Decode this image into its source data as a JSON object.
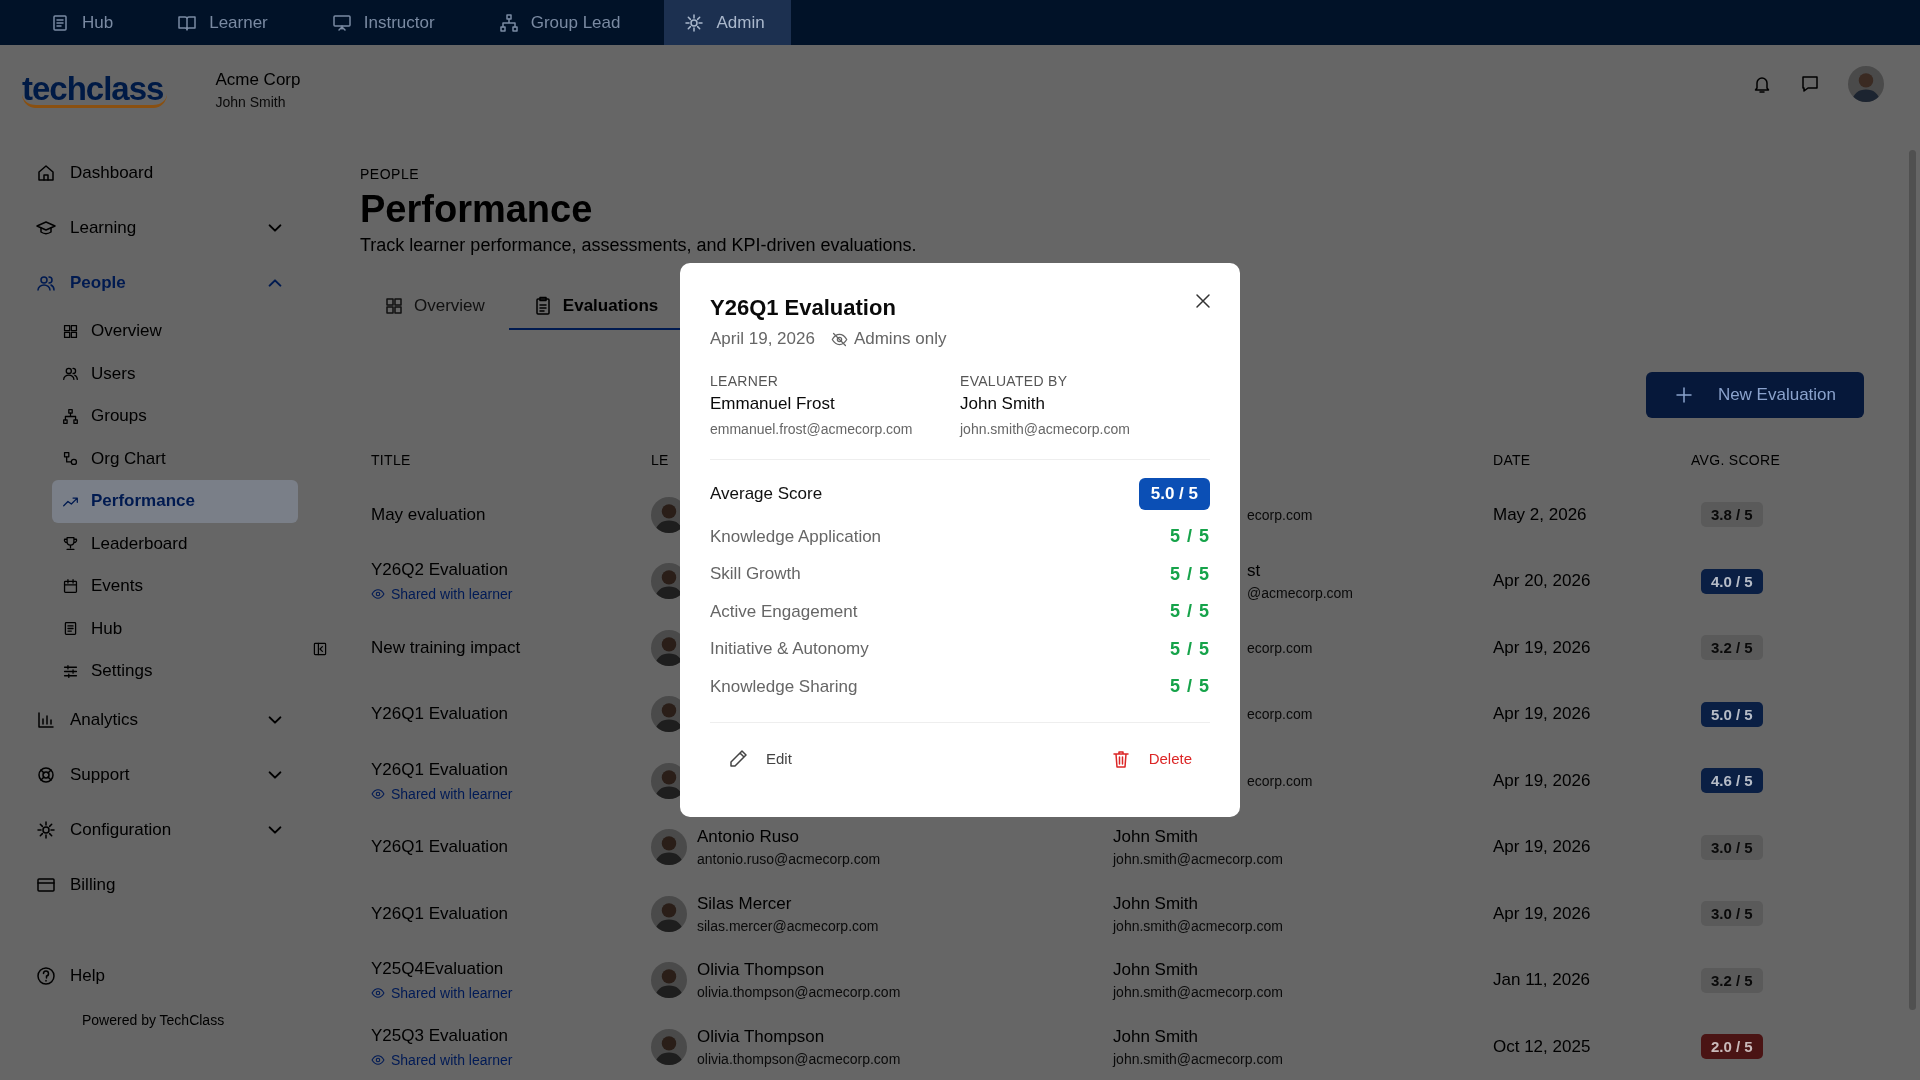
{
  "top_nav": [
    {
      "label": "Hub",
      "selected": false
    },
    {
      "label": "Learner",
      "selected": false
    },
    {
      "label": "Instructor",
      "selected": false
    },
    {
      "label": "Group Lead",
      "selected": false
    },
    {
      "label": "Admin",
      "selected": true
    }
  ],
  "header": {
    "logo": "techclass",
    "org": "Acme Corp",
    "user": "John Smith"
  },
  "sidebar": {
    "items": [
      {
        "label": "Dashboard",
        "selected": false
      },
      {
        "label": "Learning",
        "selected": false,
        "expanded": false
      },
      {
        "label": "People",
        "selected": false,
        "expanded": true,
        "children": [
          {
            "label": "Overview",
            "selected": false
          },
          {
            "label": "Users",
            "selected": false
          },
          {
            "label": "Groups",
            "selected": false
          },
          {
            "label": "Org Chart",
            "selected": false
          },
          {
            "label": "Performance",
            "selected": true
          },
          {
            "label": "Leaderboard",
            "selected": false
          },
          {
            "label": "Events",
            "selected": false
          },
          {
            "label": "Hub",
            "selected": false
          },
          {
            "label": "Settings",
            "selected": false
          }
        ]
      },
      {
        "label": "Analytics",
        "selected": false,
        "expanded": false
      },
      {
        "label": "Support",
        "selected": false,
        "expanded": false
      },
      {
        "label": "Configuration",
        "selected": false,
        "expanded": false
      },
      {
        "label": "Billing",
        "selected": false
      }
    ],
    "help": "Help",
    "footer": "Powered by TechClass"
  },
  "page": {
    "eyebrow": "PEOPLE",
    "title": "Performance",
    "subtitle": "Track learner performance, assessments, and KPI-driven evaluations."
  },
  "tabs": [
    {
      "label": "Overview",
      "selected": false
    },
    {
      "label": "Evaluations",
      "selected": true
    }
  ],
  "new_button": "New Evaluation",
  "table": {
    "columns": [
      "TITLE",
      "LE",
      "DATE",
      "AVG. SCORE"
    ],
    "rows": [
      {
        "title": "May evaluation",
        "evaluator": {
          "email": "ecorp.com"
        },
        "date": "May 2, 2026",
        "score": "3.8 / 5",
        "color": "#5a5a5a"
      },
      {
        "title": "Y26Q2 Evaluation",
        "note": "Shared with learner",
        "evaluator": {
          "name": "st",
          "email": "@acmecorp.com"
        },
        "date": "Apr 20, 2026",
        "score": "4.0 / 5",
        "color": "#0a1f44"
      },
      {
        "title": "New training impact",
        "evaluator": {
          "email": "ecorp.com"
        },
        "date": "Apr 19, 2026",
        "score": "3.2 / 5",
        "color": "#5a5a5a"
      },
      {
        "title": "Y26Q1 Evaluation",
        "evaluator": {
          "email": "ecorp.com"
        },
        "date": "Apr 19, 2026",
        "score": "5.0 / 5",
        "color": "#0a1f44"
      },
      {
        "title": "Y26Q1 Evaluation",
        "note": "Shared with learner",
        "evaluator": {
          "email": "ecorp.com"
        },
        "date": "Apr 19, 2026",
        "score": "4.6 / 5",
        "color": "#0a1f44"
      },
      {
        "title": "Y26Q1 Evaluation",
        "learner": {
          "name": "Antonio Ruso",
          "email": "antonio.ruso@acmecorp.com"
        },
        "evaluator": {
          "name": "John Smith",
          "email": "john.smith@acmecorp.com"
        },
        "date": "Apr 19, 2026",
        "score": "3.0 / 5",
        "color": "#5a5a5a"
      },
      {
        "title": "Y26Q1 Evaluation",
        "learner": {
          "name": "Silas Mercer",
          "email": "silas.mercer@acmecorp.com"
        },
        "evaluator": {
          "name": "John Smith",
          "email": "john.smith@acmecorp.com"
        },
        "date": "Apr 19, 2026",
        "score": "3.0 / 5",
        "color": "#5a5a5a"
      },
      {
        "title": "Y25Q4Evaluation",
        "note": "Shared with learner",
        "learner": {
          "name": "Olivia Thompson",
          "email": "olivia.thompson@acmecorp.com"
        },
        "evaluator": {
          "name": "John Smith",
          "email": "john.smith@acmecorp.com"
        },
        "date": "Jan 11, 2026",
        "score": "3.2 / 5",
        "color": "#5a5a5a"
      },
      {
        "title": "Y25Q3 Evaluation",
        "note": "Shared with learner",
        "learner": {
          "name": "Olivia Thompson",
          "email": "olivia.thompson@acmecorp.com"
        },
        "evaluator": {
          "name": "John Smith",
          "email": "john.smith@acmecorp.com"
        },
        "date": "Oct 12, 2025",
        "score": "2.0 / 5",
        "color": "#4a1414"
      }
    ]
  },
  "modal": {
    "title": "Y26Q1 Evaluation",
    "date": "April 19, 2026",
    "visibility": "Admins only",
    "learner": {
      "label": "LEARNER",
      "name": "Emmanuel Frost",
      "email": "emmanuel.frost@acmecorp.com"
    },
    "evaluator": {
      "label": "EVALUATED BY",
      "name": "John Smith",
      "email": "john.smith@acmecorp.com"
    },
    "average": {
      "label": "Average Score",
      "score": "5.0 / 5"
    },
    "criteria": [
      {
        "label": "Knowledge Application",
        "score": "5 / 5"
      },
      {
        "label": "Skill Growth",
        "score": "5 / 5"
      },
      {
        "label": "Active Engagement",
        "score": "5 / 5"
      },
      {
        "label": "Initiative & Autonomy",
        "score": "5 / 5"
      },
      {
        "label": "Knowledge Sharing",
        "score": "5 / 5"
      }
    ],
    "actions": [
      {
        "kind": "edit",
        "label": "Edit"
      },
      {
        "kind": "delete",
        "label": "Delete"
      }
    ]
  }
}
